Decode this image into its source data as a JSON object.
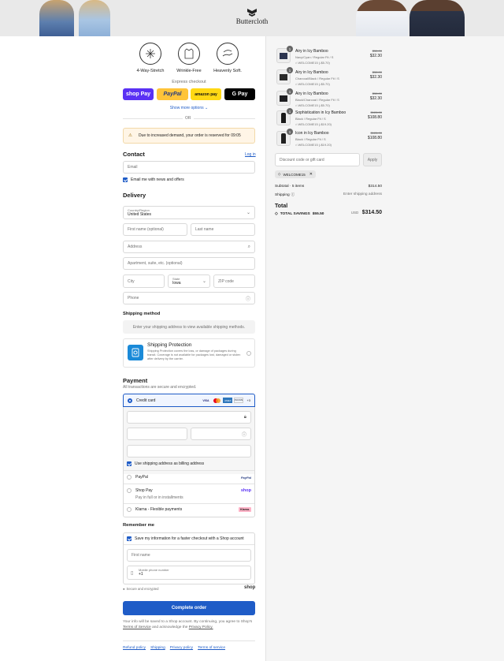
{
  "brand": {
    "name": "Buttercloth"
  },
  "features": [
    {
      "label": "4-Way-Stretch",
      "icon": "stretch-icon"
    },
    {
      "label": "Wrinkle-Free",
      "icon": "shirt-icon"
    },
    {
      "label": "Heavenly Soft.",
      "icon": "hand-feather-icon"
    }
  ],
  "express": {
    "title": "Express checkout",
    "shop_pay": "shop Pay",
    "paypal": "PayPal",
    "amazon_pay": "amazon pay",
    "google_pay": "G Pay",
    "show_more": "Show more options",
    "or": "OR"
  },
  "notice": "Due to increased demand, your order is reserved for 09:05",
  "contact": {
    "title": "Contact",
    "login": "Log in",
    "email_placeholder": "Email",
    "news_label": "Email me with news and offers"
  },
  "delivery": {
    "title": "Delivery",
    "country_label": "Country/Region",
    "country_value": "United States",
    "first_name": "First name (optional)",
    "last_name": "Last name",
    "address": "Address",
    "apartment": "Apartment, suite, etc. (optional)",
    "city": "City",
    "state_label": "State",
    "state_value": "Iowa",
    "zip": "ZIP code",
    "phone": "Phone"
  },
  "shipping": {
    "title": "Shipping method",
    "placeholder": "Enter your shipping address to view available shipping methods.",
    "protection_title": "Shipping Protection",
    "protection_text": "Shipping Protection covers the loss, or damage of packages during transit. Coverage is not available for packages lost, damaged or stolen after delivery by the carrier."
  },
  "payment": {
    "title": "Payment",
    "subtitle": "All transactions are secure and encrypted.",
    "credit_card": "Credit card",
    "card_brands": [
      "VISA",
      "MC",
      "AMEX",
      "DISCOVER"
    ],
    "more_brands": "+3",
    "billing_label": "Use shipping address as billing address",
    "paypal": "PayPal",
    "paypal_logo": "PayPal",
    "shop_pay": "Shop Pay",
    "shop_pay_sub": "Pay in full or in installments",
    "shop_logo": "shop",
    "klarna": "Klarna - Flexible payments",
    "klarna_logo": "Klarna."
  },
  "remember": {
    "title": "Remember me",
    "save_label": "Save my information for a faster checkout with a Shop account",
    "first_name": "First name",
    "mobile_label": "Mobile phone number",
    "mobile_prefix": "+1",
    "secure": "Secure and encrypted",
    "shop": "shop"
  },
  "complete_button": "Complete order",
  "legal": {
    "text1": "Your info will be saved to a Shop account. By continuing, you agree to Shop's",
    "terms": "Terms of Service",
    "text2": "and acknowledge the",
    "privacy": "Privacy Policy."
  },
  "footer_links": [
    "Refund policy",
    "Shipping",
    "Privacy policy",
    "Terms of service"
  ],
  "cart": {
    "items": [
      {
        "qty": "1",
        "name": "Airy in Icy Bamboo",
        "variant": "Navy/Cyan / Regular Fit / S",
        "discount": "WELCOME15 (-$5.70)",
        "original": "$38.00",
        "price": "$32.30",
        "swatch": "#2c3550"
      },
      {
        "qty": "1",
        "name": "Airy in Icy Bamboo",
        "variant": "Charcoal/Black / Regular Fit / S",
        "discount": "WELCOME15 (-$5.70)",
        "original": "$38.00",
        "price": "$32.30",
        "swatch": "#2b2b2b"
      },
      {
        "qty": "1",
        "name": "Airy in Icy Bamboo",
        "variant": "Black/Charcoal / Regular Fit / S",
        "discount": "WELCOME15 (-$5.70)",
        "original": "$38.00",
        "price": "$32.30",
        "swatch": "#1f1f22"
      },
      {
        "qty": "1",
        "name": "Sophistication in Icy Bamboo",
        "variant": "Black / Regular Fit / S",
        "discount": "WELCOME15 (-$19.20)",
        "original": "$128.00",
        "price": "$108.80",
        "swatch": "#1a1a1a"
      },
      {
        "qty": "1",
        "name": "Icon in Icy Bamboo",
        "variant": "Black / Regular Fit / S",
        "discount": "WELCOME15 (-$19.20)",
        "original": "$128.00",
        "price": "$108.80",
        "swatch": "#202020"
      }
    ],
    "discount_placeholder": "Discount code or gift card",
    "apply": "Apply",
    "applied_code": "WELCOME15",
    "subtotal_label": "Subtotal · 5 items",
    "subtotal_value": "$314.50",
    "shipping_label": "Shipping",
    "shipping_value": "Enter shipping address",
    "total_label": "Total",
    "currency": "USD",
    "total_value": "$314.50",
    "savings_label": "TOTAL SAVINGS",
    "savings_value": "$55.50"
  }
}
